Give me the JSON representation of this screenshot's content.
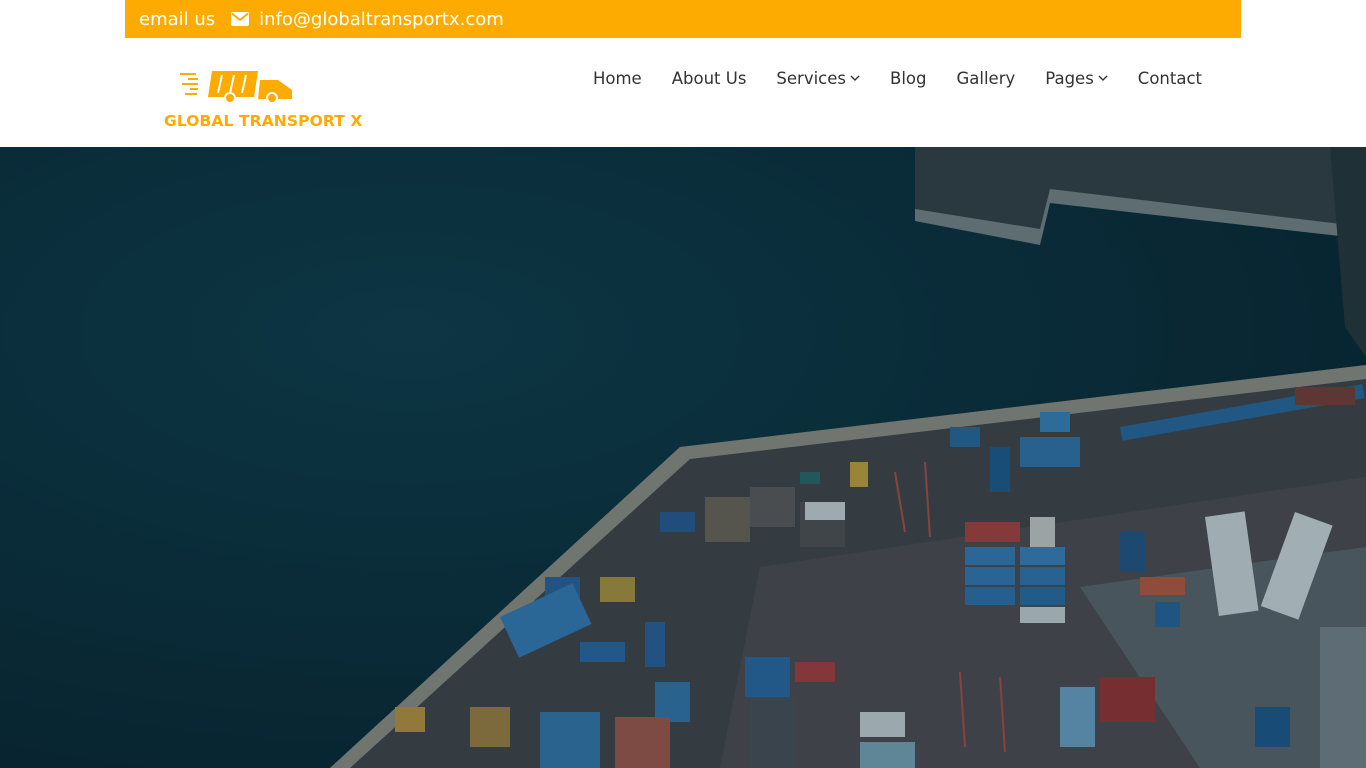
{
  "topbar": {
    "label": "email us",
    "email": "info@globaltransportx.com",
    "icon": "envelope-icon",
    "background": "#fdab00"
  },
  "brand": {
    "name": "GLOBAL TRANSPORT X",
    "logo_icon": "delivery-truck-icon",
    "color": "#fdab00"
  },
  "nav": {
    "items": [
      {
        "label": "Home",
        "dropdown": false
      },
      {
        "label": "About Us",
        "dropdown": false
      },
      {
        "label": "Services",
        "dropdown": true
      },
      {
        "label": "Blog",
        "dropdown": false
      },
      {
        "label": "Gallery",
        "dropdown": false
      },
      {
        "label": "Pages",
        "dropdown": true
      },
      {
        "label": "Contact",
        "dropdown": false
      }
    ]
  },
  "hero": {
    "image": "aerial-port-image",
    "overlay_color": "#0b2f3c"
  }
}
